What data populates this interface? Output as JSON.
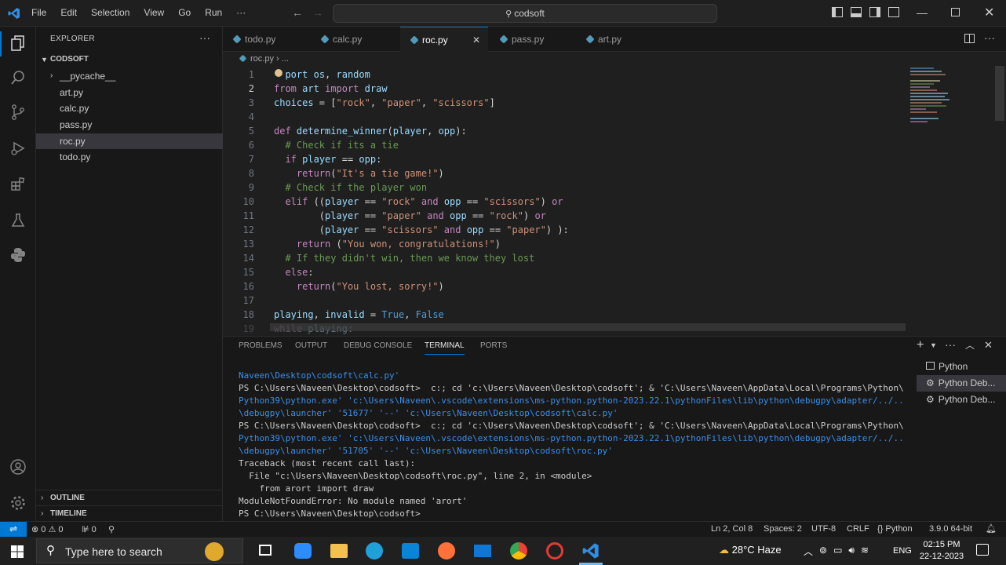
{
  "menu": {
    "file": "File",
    "edit": "Edit",
    "selection": "Selection",
    "view": "View",
    "go": "Go",
    "run": "Run",
    "more": "···"
  },
  "search": {
    "label": "codsoft"
  },
  "explorer": {
    "title": "EXPLORER",
    "folder": "CODSOFT",
    "items": [
      "__pycache__",
      "art.py",
      "calc.py",
      "pass.py",
      "roc.py",
      "todo.py"
    ],
    "outline": "OUTLINE",
    "timeline": "TIMELINE"
  },
  "tabs": [
    "todo.py",
    "calc.py",
    "roc.py",
    "pass.py",
    "art.py"
  ],
  "breadcrumb": {
    "file": "roc.py",
    "rest": "› ..."
  },
  "code": [
    {
      "n": "1",
      "t": "  port os, random"
    },
    {
      "n": "2",
      "t": "from art import draw"
    },
    {
      "n": "3",
      "t": "choices = [\"rock\", \"paper\", \"scissors\"]"
    },
    {
      "n": "4",
      "t": ""
    },
    {
      "n": "5",
      "t": "def determine_winner(player, opp):"
    },
    {
      "n": "6",
      "t": "  # Check if its a tie"
    },
    {
      "n": "7",
      "t": "  if player == opp:"
    },
    {
      "n": "8",
      "t": "    return(\"It's a tie game!\")"
    },
    {
      "n": "9",
      "t": "  # Check if the player won"
    },
    {
      "n": "10",
      "t": "  elif ((player == \"rock\" and opp == \"scissors\") or"
    },
    {
      "n": "11",
      "t": "        (player == \"paper\" and opp == \"rock\") or"
    },
    {
      "n": "12",
      "t": "        (player == \"scissors\" and opp == \"paper\") ):"
    },
    {
      "n": "13",
      "t": "    return (\"You won, congratulations!\")"
    },
    {
      "n": "14",
      "t": "  # If they didn't win, then we know they lost"
    },
    {
      "n": "15",
      "t": "  else:"
    },
    {
      "n": "16",
      "t": "    return(\"You lost, sorry!\")"
    },
    {
      "n": "17",
      "t": ""
    },
    {
      "n": "18",
      "t": "playing, invalid = True, False"
    },
    {
      "n": "19",
      "t": "while playing:"
    }
  ],
  "panel": {
    "tabs": [
      "PROBLEMS",
      "OUTPUT",
      "DEBUG CONSOLE",
      "TERMINAL",
      "PORTS"
    ],
    "terminals": [
      "Python",
      "Python Deb...",
      "Python Deb..."
    ],
    "lines": [
      "Naveen\\Desktop\\codsoft\\calc.py'",
      "PS C:\\Users\\Naveen\\Desktop\\codsoft>  c:; cd 'c:\\Users\\Naveen\\Desktop\\codsoft'; & 'C:\\Users\\Naveen\\AppData\\Local\\Programs\\Python\\",
      "Python39\\python.exe' 'c:\\Users\\Naveen\\.vscode\\extensions\\ms-python.python-2023.22.1\\pythonFiles\\lib\\python\\debugpy\\adapter/../..",
      "\\debugpy\\launcher' '51677' '--' 'c:\\Users\\Naveen\\Desktop\\codsoft\\calc.py'",
      "PS C:\\Users\\Naveen\\Desktop\\codsoft>  c:; cd 'c:\\Users\\Naveen\\Desktop\\codsoft'; & 'C:\\Users\\Naveen\\AppData\\Local\\Programs\\Python\\",
      "Python39\\python.exe' 'c:\\Users\\Naveen\\.vscode\\extensions\\ms-python.python-2023.22.1\\pythonFiles\\lib\\python\\debugpy\\adapter/../..",
      "\\debugpy\\launcher' '51705' '--' 'c:\\Users\\Naveen\\Desktop\\codsoft\\roc.py'",
      "Traceback (most recent call last):",
      "  File \"c:\\Users\\Naveen\\Desktop\\codsoft\\roc.py\", line 2, in <module>",
      "    from arort import draw",
      "ModuleNotFoundError: No module named 'arort'",
      "PS C:\\Users\\Naveen\\Desktop\\codsoft>"
    ]
  },
  "status": {
    "errors": "0",
    "warnings": "0",
    "ports": "0",
    "position": "Ln 2, Col 8",
    "spaces": "Spaces: 2",
    "encoding": "UTF-8",
    "eol": "CRLF",
    "language": "Python",
    "interpreter": "3.9.0 64-bit"
  },
  "taskbar": {
    "search": "Type here to search",
    "weather": "28°C  Haze",
    "lang": "ENG",
    "time": "02:15 PM",
    "date": "22-12-2023"
  },
  "colors": {
    "accent": "#0078d4",
    "keyword": "#569cd6",
    "string": "#ce9178",
    "comment": "#6a9955"
  }
}
